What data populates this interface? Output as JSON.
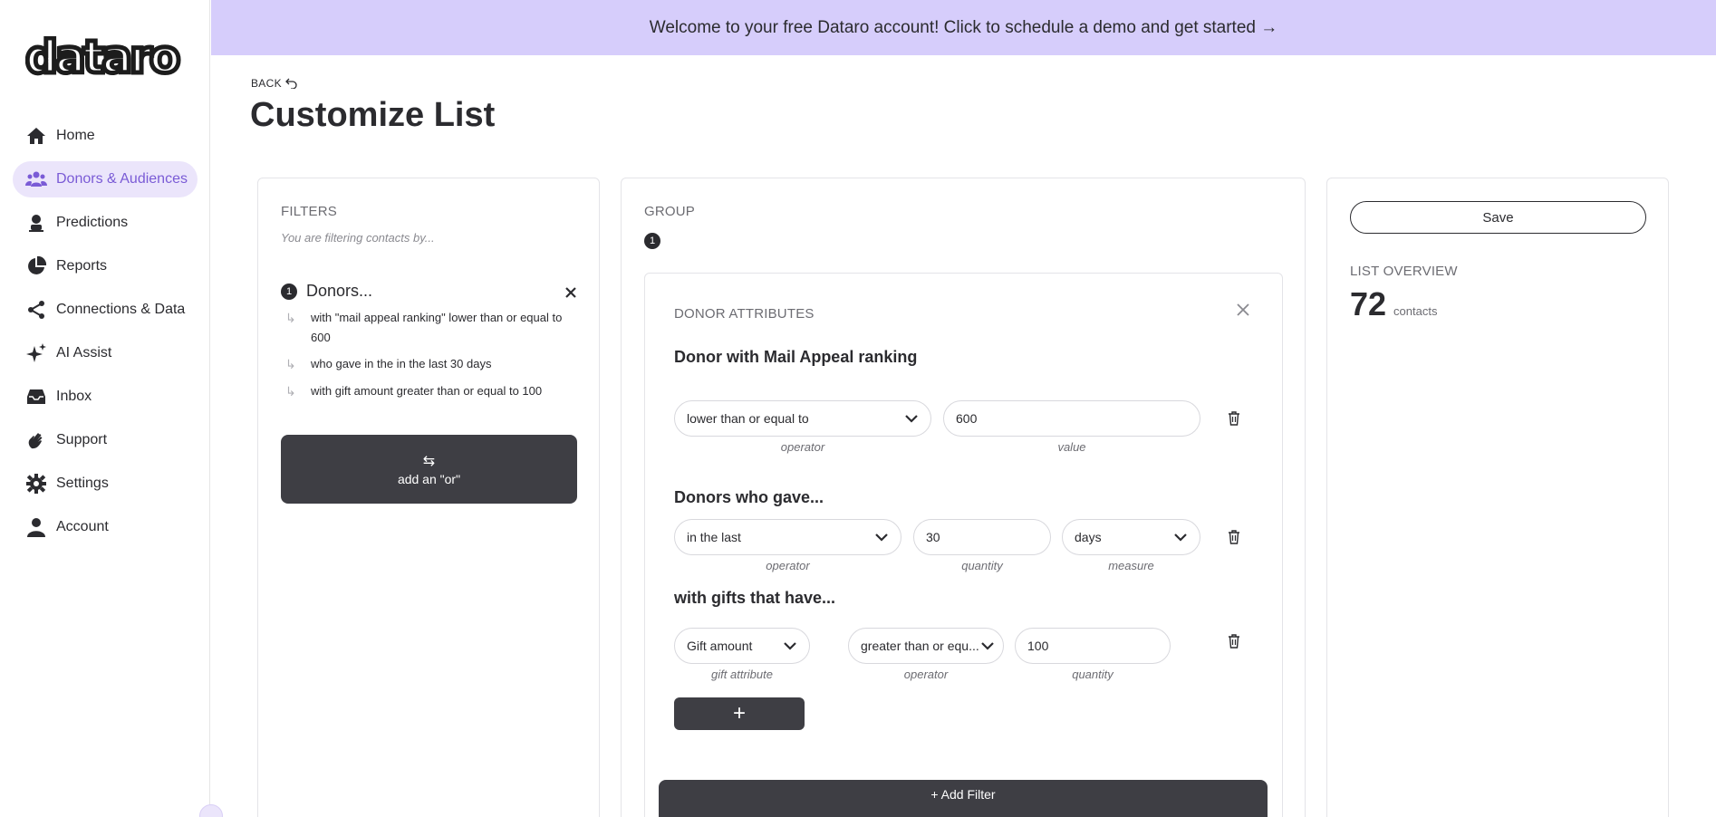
{
  "app": {
    "logo": "dataro"
  },
  "banner": {
    "text": "Welcome to your free Dataro account! Click to schedule a demo and get started →"
  },
  "sidebar": {
    "items": [
      {
        "label": "Home",
        "icon": "home-icon",
        "active": false
      },
      {
        "label": "Donors & Audiences",
        "icon": "people-icon",
        "active": true
      },
      {
        "label": "Predictions",
        "icon": "fortune-teller-icon",
        "active": false
      },
      {
        "label": "Reports",
        "icon": "pie-chart-icon",
        "active": false
      },
      {
        "label": "Connections & Data",
        "icon": "share-icon",
        "active": false
      },
      {
        "label": "AI Assist",
        "icon": "sparkles-icon",
        "active": false
      },
      {
        "label": "Inbox",
        "icon": "inbox-icon",
        "active": false
      },
      {
        "label": "Support",
        "icon": "waving-hand-icon",
        "active": false
      },
      {
        "label": "Settings",
        "icon": "gear-icon",
        "active": false
      },
      {
        "label": "Account",
        "icon": "user-icon",
        "active": false
      }
    ]
  },
  "header": {
    "back_label": "BACK",
    "title": "Customize List"
  },
  "filters": {
    "label": "FILTERS",
    "subtitle": "You are filtering contacts by...",
    "group_number": "1",
    "group_title": "Donors...",
    "rules": [
      "with \"mail appeal ranking\" lower than or equal to 600",
      "who gave in the in the last 30 days",
      "with gift amount greater than or equal to 100"
    ],
    "or_button": "add an \"or\""
  },
  "group": {
    "label": "GROUP",
    "number": "1",
    "card_label": "DONOR ATTRIBUTES",
    "section1": {
      "title": "Donor with Mail Appeal ranking",
      "operator": "lower than or equal to",
      "value": "600",
      "operator_caption": "operator",
      "value_caption": "value"
    },
    "section2": {
      "title": "Donors who gave...",
      "operator": "in the last",
      "quantity": "30",
      "measure": "days",
      "operator_caption": "operator",
      "quantity_caption": "quantity",
      "measure_caption": "measure"
    },
    "section3": {
      "title": "with gifts that have...",
      "attribute": "Gift amount",
      "operator": "greater than or equ...",
      "quantity": "100",
      "attribute_caption": "gift attribute",
      "operator_caption": "operator",
      "quantity_caption": "quantity"
    },
    "plus_button": "+",
    "add_filter_button": "+ Add Filter"
  },
  "overview": {
    "save_label": "Save",
    "label": "LIST OVERVIEW",
    "count": "72",
    "unit": "contacts"
  },
  "colors": {
    "accent": "#7a5bd6",
    "banner": "#d6cdfb",
    "dark_button": "#3e3e44"
  }
}
